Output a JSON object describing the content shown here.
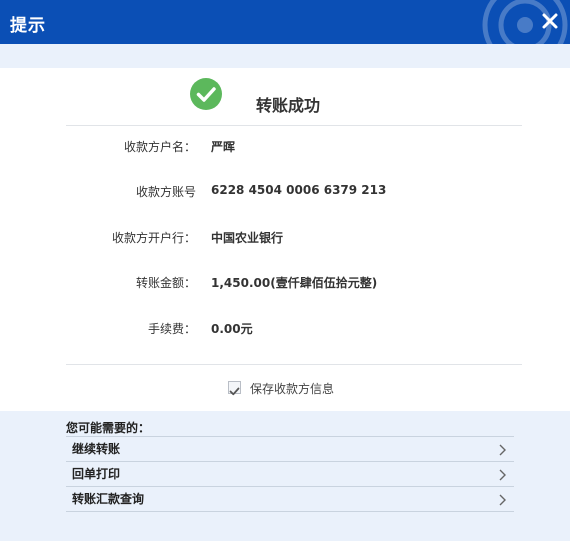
{
  "dialog": {
    "title": "提示"
  },
  "result": {
    "message": "转账成功",
    "status_color": "#5cb85c"
  },
  "details": [
    {
      "label": "收款方户名：",
      "value": "严晖"
    },
    {
      "label": "收款方账号",
      "value": "6228 4504 0006 6379 213"
    },
    {
      "label": "收款方开户行：",
      "value": "中国农业银行"
    },
    {
      "label": "转账金额：",
      "value": "1,450.00(壹仟肆佰伍拾元整)"
    },
    {
      "label": "手续费：",
      "value": "0.00元"
    }
  ],
  "save_payee": {
    "label": "保存收款方信息",
    "checked": true
  },
  "suggestions": {
    "heading": "您可能需要的：",
    "items": [
      {
        "label": "继续转账"
      },
      {
        "label": "回单打印"
      },
      {
        "label": "转账汇款查询"
      }
    ]
  },
  "colors": {
    "titlebar": "#0b4fb5",
    "band": "#eaf1fb"
  }
}
